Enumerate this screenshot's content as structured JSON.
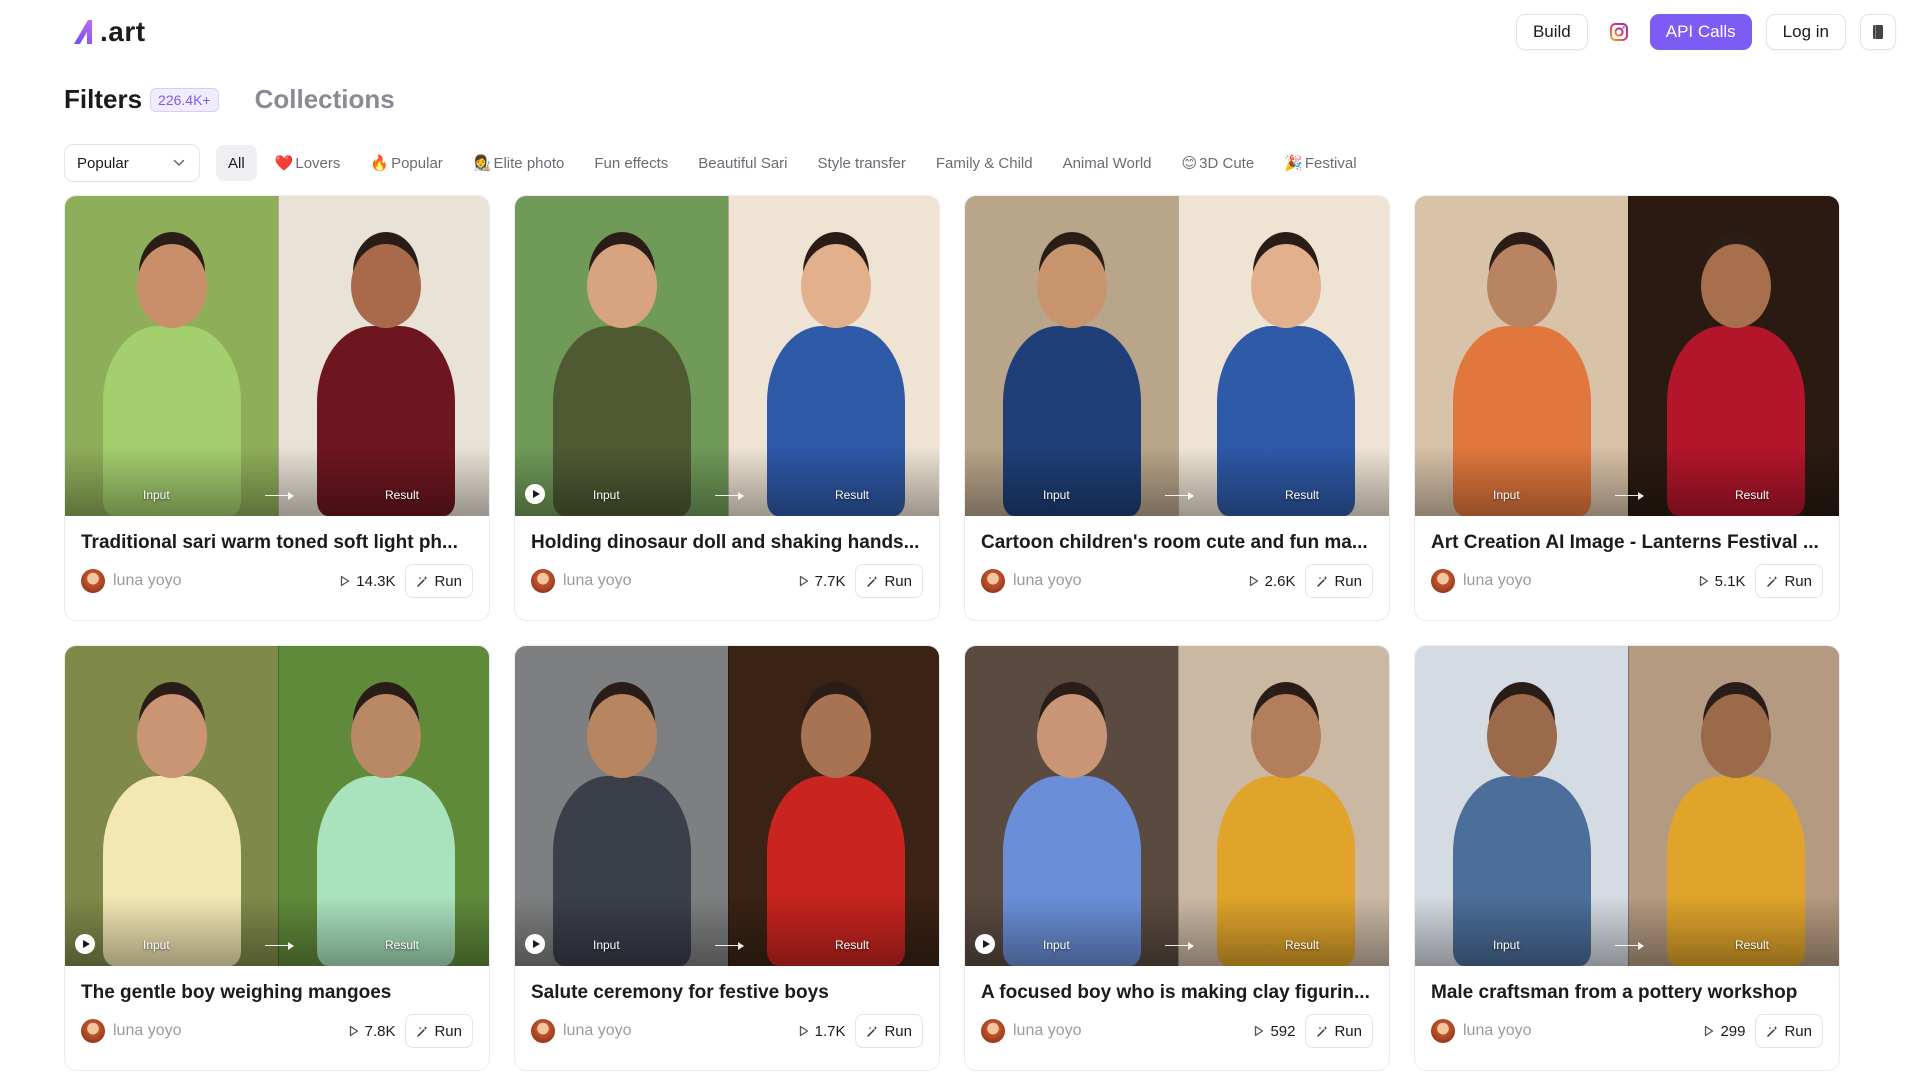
{
  "brand": {
    "logo_text": ".art"
  },
  "nav": {
    "build_label": "Build",
    "api_calls_label": "API Calls",
    "login_label": "Log in"
  },
  "title_row": {
    "filters_label": "Filters",
    "count_badge": "226.4K+",
    "collections_label": "Collections"
  },
  "sort": {
    "selected": "Popular"
  },
  "chips": [
    {
      "emoji": "",
      "label": "All",
      "active": true
    },
    {
      "emoji": "❤️",
      "label": "Lovers"
    },
    {
      "emoji": "🔥",
      "label": "Popular"
    },
    {
      "emoji": "👩‍🎨",
      "label": "Elite photo"
    },
    {
      "emoji": "",
      "label": "Fun effects"
    },
    {
      "emoji": "",
      "label": "Beautiful Sari"
    },
    {
      "emoji": "",
      "label": "Style transfer"
    },
    {
      "emoji": "",
      "label": "Family & Child"
    },
    {
      "emoji": "",
      "label": "Animal World"
    },
    {
      "emoji": "😊",
      "label": "3D Cute"
    },
    {
      "emoji": "🎉",
      "label": "Festival"
    }
  ],
  "thumb_labels": {
    "input": "Input",
    "result": "Result"
  },
  "run_label": "Run",
  "cards": [
    {
      "title": "Traditional sari warm toned soft light ph...",
      "author": "luna yoyo",
      "runs": "14.3K",
      "play": false,
      "colors": {
        "in_bg": "#8fae5a",
        "in_body": "#a4cf6e",
        "in_head": "#c98f6b",
        "out_bg": "#e9e2d6",
        "out_body": "#6e1620",
        "out_head": "#a86a4a"
      }
    },
    {
      "title": "Holding dinosaur doll and shaking hands...",
      "author": "luna yoyo",
      "runs": "7.7K",
      "play": true,
      "colors": {
        "in_bg": "#6f9a58",
        "in_body": "#4f5a33",
        "in_head": "#d7a47f",
        "out_bg": "#efe4d4",
        "out_body": "#2e5aa8",
        "out_head": "#e2b08c"
      }
    },
    {
      "title": "Cartoon children's room cute and fun ma...",
      "author": "luna yoyo",
      "runs": "2.6K",
      "play": false,
      "colors": {
        "in_bg": "#b9a58a",
        "in_body": "#1f3f78",
        "in_head": "#c8946e",
        "out_bg": "#efe4d4",
        "out_body": "#2e5aa8",
        "out_head": "#e2b08c"
      }
    },
    {
      "title": "Art Creation AI Image - Lanterns Festival ...",
      "author": "luna yoyo",
      "runs": "5.1K",
      "play": false,
      "colors": {
        "in_bg": "#d8c2a8",
        "in_body": "#e2773e",
        "in_head": "#b88462",
        "out_bg": "#2a1a12",
        "out_body": "#b3152a",
        "out_head": "#a86f4d"
      }
    },
    {
      "title": "The gentle boy weighing mangoes",
      "author": "luna yoyo",
      "runs": "7.8K",
      "play": true,
      "colors": {
        "in_bg": "#7f8a4a",
        "in_body": "#f3e7b4",
        "in_head": "#c99574",
        "out_bg": "#5f8a3a",
        "out_body": "#a9e3bd",
        "out_head": "#b98865"
      }
    },
    {
      "title": "Salute ceremony for festive boys",
      "author": "luna yoyo",
      "runs": "1.7K",
      "play": true,
      "colors": {
        "in_bg": "#7e7f80",
        "in_body": "#3b3f4a",
        "in_head": "#b7855f",
        "out_bg": "#3a2214",
        "out_body": "#c9241f",
        "out_head": "#a87352"
      }
    },
    {
      "title": "A focused boy who is making clay figurin...",
      "author": "luna yoyo",
      "runs": "592",
      "play": true,
      "colors": {
        "in_bg": "#5a4a40",
        "in_body": "#6a8fd8",
        "in_head": "#c89677",
        "out_bg": "#cbb8a3",
        "out_body": "#e0a42a",
        "out_head": "#b37e5c"
      }
    },
    {
      "title": "Male craftsman from a pottery workshop",
      "author": "luna yoyo",
      "runs": "299",
      "play": false,
      "colors": {
        "in_bg": "#d5dbe2",
        "in_body": "#4c6e9a",
        "in_head": "#9a6a4b",
        "out_bg": "#b49a80",
        "out_body": "#e0a42a",
        "out_head": "#9c6a48"
      }
    }
  ]
}
